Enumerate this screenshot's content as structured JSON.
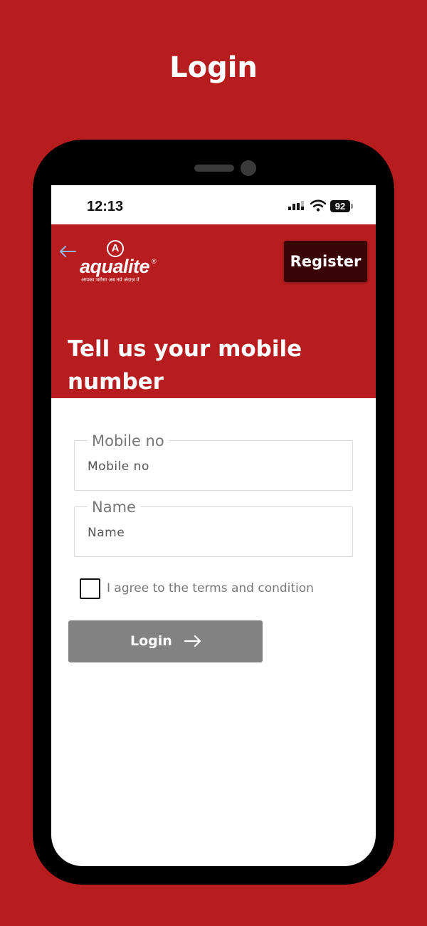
{
  "page": {
    "heading": "Login"
  },
  "status_bar": {
    "time": "12:13",
    "battery": "92"
  },
  "brand": {
    "name": "aqualite",
    "mark": "A",
    "registered": "®",
    "tagline": "आपका भरोसा अब नये अंदाज़ में"
  },
  "header": {
    "register_label": "Register",
    "title": "Tell us your mobile number"
  },
  "form": {
    "mobile": {
      "legend": "Mobile no",
      "placeholder": "Mobile no"
    },
    "name": {
      "legend": "Name",
      "placeholder": "Name"
    },
    "agree_label": "I agree to the terms and condition",
    "login_label": "Login"
  },
  "colors": {
    "brand_red": "#b71c1f",
    "register_bg": "#3a0407",
    "login_disabled": "#828282"
  },
  "icons": {
    "back": "arrow-left-icon",
    "login_arrow": "arrow-right-icon",
    "signal": "signal-icon",
    "wifi": "wifi-icon"
  }
}
